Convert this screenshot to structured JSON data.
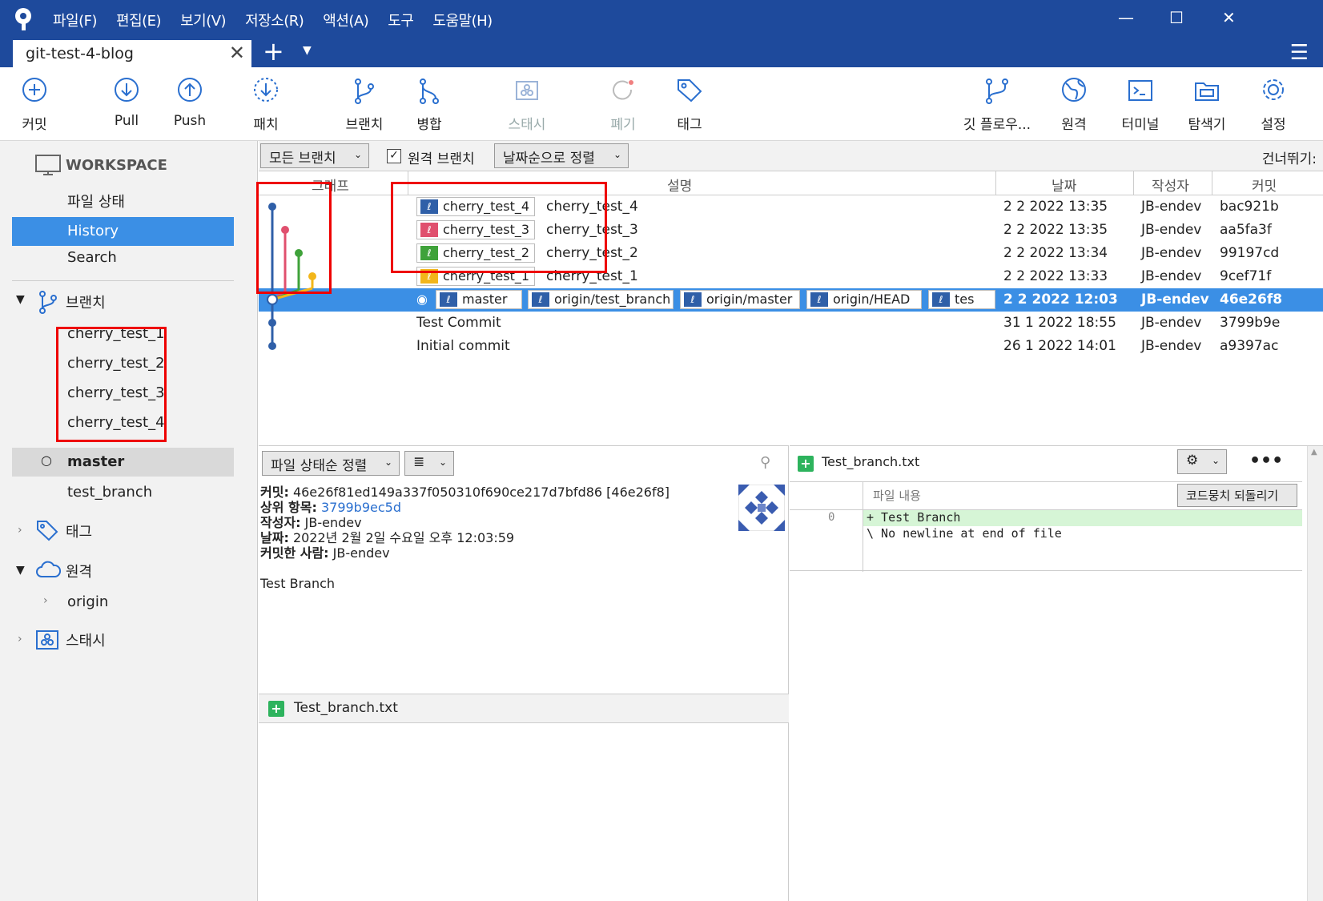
{
  "titlebar": {
    "menus": [
      "파일(F)",
      "편집(E)",
      "보기(V)",
      "저장소(R)",
      "액션(A)",
      "도구",
      "도움말(H)"
    ]
  },
  "tab": {
    "title": "git-test-4-blog",
    "close": "✕",
    "new": "+"
  },
  "toolbar": {
    "commit": "커밋",
    "pull": "Pull",
    "push": "Push",
    "patch": "패치",
    "branch": "브랜치",
    "merge": "병합",
    "stash": "스태시",
    "discard": "폐기",
    "tag": "태그",
    "gitflow": "깃 플로우...",
    "remote": "원격",
    "terminal": "터미널",
    "explorer": "탐색기",
    "settings": "설정"
  },
  "sidebar": {
    "workspace": "WORKSPACE",
    "file_status": "파일 상태",
    "history": "History",
    "search": "Search",
    "branches_header": "브랜치",
    "branches": [
      "cherry_test_1",
      "cherry_test_2",
      "cherry_test_3",
      "cherry_test_4",
      "master",
      "test_branch"
    ],
    "tags_header": "태그",
    "remotes_header": "원격",
    "remote_origin": "origin",
    "stash_header": "스태시"
  },
  "filter": {
    "branches": "모든 브랜치",
    "remote_branches": "원격 브랜치",
    "sort": "날짜순으로 정렬",
    "skip": "건너뛰기:"
  },
  "columns": {
    "graph": "그래프",
    "desc": "설명",
    "date": "날짜",
    "author": "작성자",
    "commit": "커밋"
  },
  "commits": [
    {
      "badge": "cherry_test_4",
      "badge_color": "#2f5fa8",
      "desc": "cherry_test_4",
      "date": "2 2 2022 13:35",
      "author": "JB-endev",
      "hash": "bac921b"
    },
    {
      "badge": "cherry_test_3",
      "badge_color": "#e0506e",
      "desc": "cherry_test_3",
      "date": "2 2 2022 13:35",
      "author": "JB-endev",
      "hash": "aa5fa3f"
    },
    {
      "badge": "cherry_test_2",
      "badge_color": "#3fa23a",
      "desc": "cherry_test_2",
      "date": "2 2 2022 13:34",
      "author": "JB-endev",
      "hash": "99197cd"
    },
    {
      "badge": "cherry_test_1",
      "badge_color": "#f2b61a",
      "desc": "cherry_test_1",
      "date": "2 2 2022 13:33",
      "author": "JB-endev",
      "hash": "9cef71f"
    },
    {
      "badges": [
        "master",
        "origin/test_branch",
        "origin/master",
        "origin/HEAD",
        "tes"
      ],
      "date": "2 2 2022 12:03",
      "author": "JB-endev",
      "hash": "46e26f8"
    },
    {
      "desc": "Test Commit",
      "date": "31 1 2022 18:55",
      "author": "JB-endev",
      "hash": "3799b9e"
    },
    {
      "desc": "Initial commit",
      "date": "26 1 2022 14:01",
      "author": "JB-endev",
      "hash": "a9397ac"
    }
  ],
  "details": {
    "sort": "파일 상태순 정렬",
    "commit_label": "커밋:",
    "commit_value": "46e26f81ed149a337f050310f690ce217d7bfd86 [46e26f8]",
    "parent_label": "상위 항목:",
    "parent_value": "3799b9ec5d",
    "author_label": "작성자:",
    "author_value": "JB-endev",
    "date_label": "날짜:",
    "date_value": "2022년 2월 2일 수요일 오후 12:03:59",
    "committer_label": "커밋한 사람:",
    "committer_value": "JB-endev",
    "message": "Test Branch",
    "file": "Test_branch.txt"
  },
  "diff": {
    "file": "Test_branch.txt",
    "content_label": "파일 내용",
    "revert": "코드뭉치 되돌리기",
    "line_no": "0",
    "line1": "+ Test Branch",
    "line2": "\\  No newline at end of file"
  }
}
